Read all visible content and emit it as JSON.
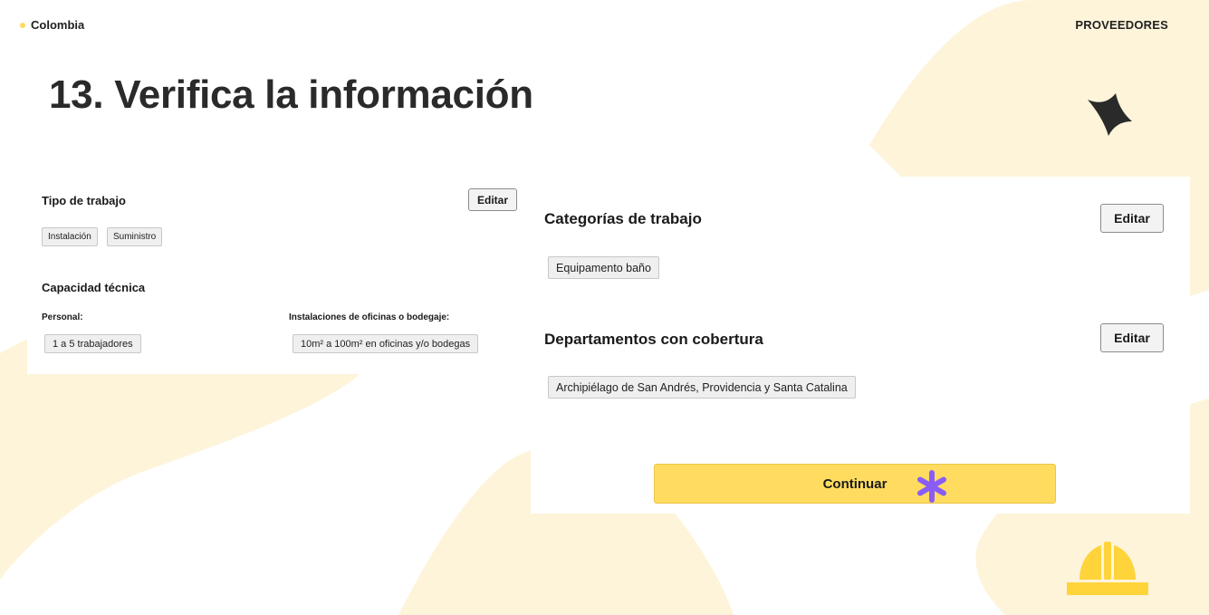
{
  "header": {
    "country": "Colombia",
    "section": "PROVEEDORES"
  },
  "page": {
    "title": "13. Verifica la información"
  },
  "left_card": {
    "tipo_trabajo": {
      "heading": "Tipo de trabajo",
      "edit_label": "Editar",
      "chips": [
        "Instalación",
        "Suministro"
      ]
    },
    "capacidad": {
      "heading": "Capacidad técnica",
      "personal_label": "Personal:",
      "personal_value": "1 a 5 trabajadores",
      "instalaciones_label": "Instalaciones de oficinas o bodegaje:",
      "instalaciones_value": "10m² a 100m² en oficinas y/o bodegas"
    }
  },
  "right_card": {
    "categorias": {
      "heading": "Categorías de trabajo",
      "edit_label": "Editar",
      "chips": [
        "Equipamento baño"
      ]
    },
    "departamentos": {
      "heading": "Departamentos con cobertura",
      "edit_label": "Editar",
      "chips": [
        "Archipiélago de San Andrés, Providencia y Santa Catalina"
      ]
    },
    "continue_label": "Continuar"
  },
  "colors": {
    "accent_yellow": "#ffdc5f",
    "background_shape": "#fdf4da",
    "asterisk": "#8a5cf6",
    "dark": "#2a2a2a"
  },
  "icons": {
    "sparkle": "four-point-star-icon",
    "cursor_mark": "asterisk-icon",
    "brand": "hard-hat-icon"
  }
}
